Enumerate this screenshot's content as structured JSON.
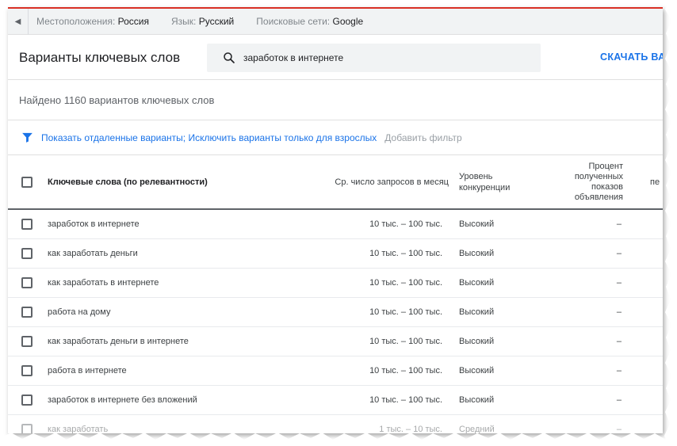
{
  "filter_bar": {
    "locations_label": "Местоположения:",
    "locations_value": "Россия",
    "language_label": "Язык:",
    "language_value": "Русский",
    "networks_label": "Поисковые сети:",
    "networks_value": "Google"
  },
  "header": {
    "title": "Варианты ключевых слов",
    "search_value": "заработок в интернете",
    "download_label": "СКАЧАТЬ ВА"
  },
  "summary": {
    "found_text": "Найдено 1160 вариантов ключевых слов"
  },
  "filters": {
    "active_filters": "Показать отдаленные варианты; Исключить варианты только для взрослых",
    "add_filter": "Добавить фильтр"
  },
  "table": {
    "columns": {
      "keyword": "Ключевые слова (по релевантности)",
      "avg_searches": "Ср. число запросов в месяц",
      "competition_line1": "Уровень",
      "competition_line2": "конкуренции",
      "impression_line1": "Процент",
      "impression_line2": "полученных",
      "impression_line3": "показов",
      "impression_line4": "объявления",
      "extra": "пе"
    },
    "rows": [
      {
        "keyword": "заработок в интернете",
        "avg": "10 тыс. – 100 тыс.",
        "competition": "Высокий",
        "impression": "–"
      },
      {
        "keyword": "как заработать деньги",
        "avg": "10 тыс. – 100 тыс.",
        "competition": "Высокий",
        "impression": "–"
      },
      {
        "keyword": "как заработать в интернете",
        "avg": "10 тыс. – 100 тыс.",
        "competition": "Высокий",
        "impression": "–"
      },
      {
        "keyword": "работа на дому",
        "avg": "10 тыс. – 100 тыс.",
        "competition": "Высокий",
        "impression": "–"
      },
      {
        "keyword": "как заработать деньги в интернете",
        "avg": "10 тыс. – 100 тыс.",
        "competition": "Высокий",
        "impression": "–"
      },
      {
        "keyword": "работа в интернете",
        "avg": "10 тыс. – 100 тыс.",
        "competition": "Высокий",
        "impression": "–"
      },
      {
        "keyword": "заработок в интернете без вложений",
        "avg": "10 тыс. – 100 тыс.",
        "competition": "Высокий",
        "impression": "–"
      },
      {
        "keyword": "как заработать",
        "avg": "1 тыс. – 10 тыс.",
        "competition": "Средний",
        "impression": "–"
      }
    ]
  },
  "colors": {
    "accent": "#1a73e8",
    "top_line": "#d93025"
  }
}
